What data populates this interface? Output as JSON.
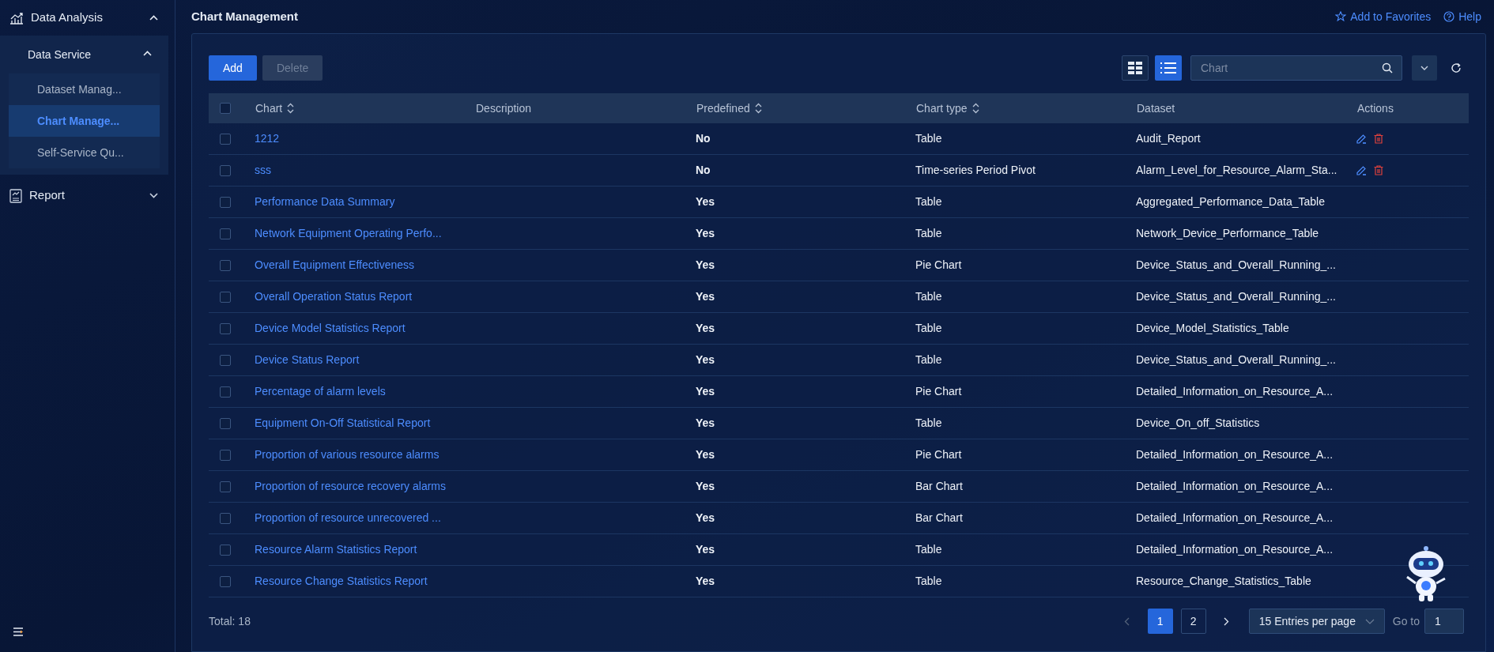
{
  "sidebar": {
    "items": [
      {
        "label": "Data Analysis",
        "expanded": true,
        "children": [
          {
            "label": "Data Service",
            "expanded": true,
            "children": [
              {
                "label": "Dataset Manag...",
                "selected": false
              },
              {
                "label": "Chart Manage...",
                "selected": true
              },
              {
                "label": "Self-Service Qu...",
                "selected": false
              }
            ]
          }
        ]
      },
      {
        "label": "Report",
        "expanded": false
      }
    ]
  },
  "header": {
    "title": "Chart Management",
    "links": [
      {
        "kind": "favorite",
        "label": "Add to Favorites"
      },
      {
        "kind": "help",
        "label": "Help"
      }
    ]
  },
  "toolbar": {
    "buttons": [
      {
        "label": "Add",
        "disabled": false
      },
      {
        "label": "Delete",
        "disabled": true
      }
    ],
    "views": [
      {
        "kind": "grid",
        "selected": false
      },
      {
        "kind": "list",
        "selected": true
      }
    ],
    "search": {
      "placeholder": "Chart"
    }
  },
  "table": {
    "all_checked": false,
    "columns": [
      {
        "label": "Chart",
        "sortable": true
      },
      {
        "label": "Description",
        "sortable": false
      },
      {
        "label": "Predefined",
        "sortable": true
      },
      {
        "label": "Chart type",
        "sortable": true
      },
      {
        "label": "Dataset",
        "sortable": false
      },
      {
        "label": "Actions",
        "sortable": false
      }
    ],
    "rows": [
      {
        "checked": false,
        "chart": "1212",
        "predefined": "No",
        "chart_type": "Table",
        "dataset": "Audit_Report",
        "editable": true
      },
      {
        "checked": false,
        "chart": "sss",
        "predefined": "No",
        "chart_type": "Time-series Period Pivot",
        "dataset": "Alarm_Level_for_Resource_Alarm_Sta...",
        "editable": true
      },
      {
        "checked": false,
        "chart": "Performance Data Summary",
        "predefined": "Yes",
        "chart_type": "Table",
        "dataset": "Aggregated_Performance_Data_Table",
        "editable": false
      },
      {
        "checked": false,
        "chart": "Network Equipment Operating Perfo...",
        "predefined": "Yes",
        "chart_type": "Table",
        "dataset": "Network_Device_Performance_Table",
        "editable": false
      },
      {
        "checked": false,
        "chart": "Overall Equipment Effectiveness",
        "predefined": "Yes",
        "chart_type": "Pie Chart",
        "dataset": "Device_Status_and_Overall_Running_...",
        "editable": false
      },
      {
        "checked": false,
        "chart": "Overall Operation Status Report",
        "predefined": "Yes",
        "chart_type": "Table",
        "dataset": "Device_Status_and_Overall_Running_...",
        "editable": false
      },
      {
        "checked": false,
        "chart": "Device Model Statistics Report",
        "predefined": "Yes",
        "chart_type": "Table",
        "dataset": "Device_Model_Statistics_Table",
        "editable": false
      },
      {
        "checked": false,
        "chart": "Device Status Report",
        "predefined": "Yes",
        "chart_type": "Table",
        "dataset": "Device_Status_and_Overall_Running_...",
        "editable": false
      },
      {
        "checked": false,
        "chart": "Percentage of alarm levels",
        "predefined": "Yes",
        "chart_type": "Pie Chart",
        "dataset": "Detailed_Information_on_Resource_A...",
        "editable": false
      },
      {
        "checked": false,
        "chart": "Equipment On-Off Statistical Report",
        "predefined": "Yes",
        "chart_type": "Table",
        "dataset": "Device_On_off_Statistics",
        "editable": false
      },
      {
        "checked": false,
        "chart": "Proportion of various resource alarms",
        "predefined": "Yes",
        "chart_type": "Pie Chart",
        "dataset": "Detailed_Information_on_Resource_A...",
        "editable": false
      },
      {
        "checked": false,
        "chart": "Proportion of resource recovery alarms",
        "predefined": "Yes",
        "chart_type": "Bar Chart",
        "dataset": "Detailed_Information_on_Resource_A...",
        "editable": false
      },
      {
        "checked": false,
        "chart": "Proportion of resource unrecovered ...",
        "predefined": "Yes",
        "chart_type": "Bar Chart",
        "dataset": "Detailed_Information_on_Resource_A...",
        "editable": false
      },
      {
        "checked": false,
        "chart": "Resource Alarm Statistics Report",
        "predefined": "Yes",
        "chart_type": "Table",
        "dataset": "Detailed_Information_on_Resource_A...",
        "editable": false
      },
      {
        "checked": false,
        "chart": "Resource Change Statistics Report",
        "predefined": "Yes",
        "chart_type": "Table",
        "dataset": "Resource_Change_Statistics_Table",
        "editable": false
      }
    ]
  },
  "footer": {
    "total": "Total: 18",
    "pages": [
      {
        "label": "1",
        "selected": true
      },
      {
        "label": "2",
        "selected": false
      }
    ],
    "page_size": "15 Entries per page",
    "goto_label": "Go to",
    "goto_value": "1"
  }
}
